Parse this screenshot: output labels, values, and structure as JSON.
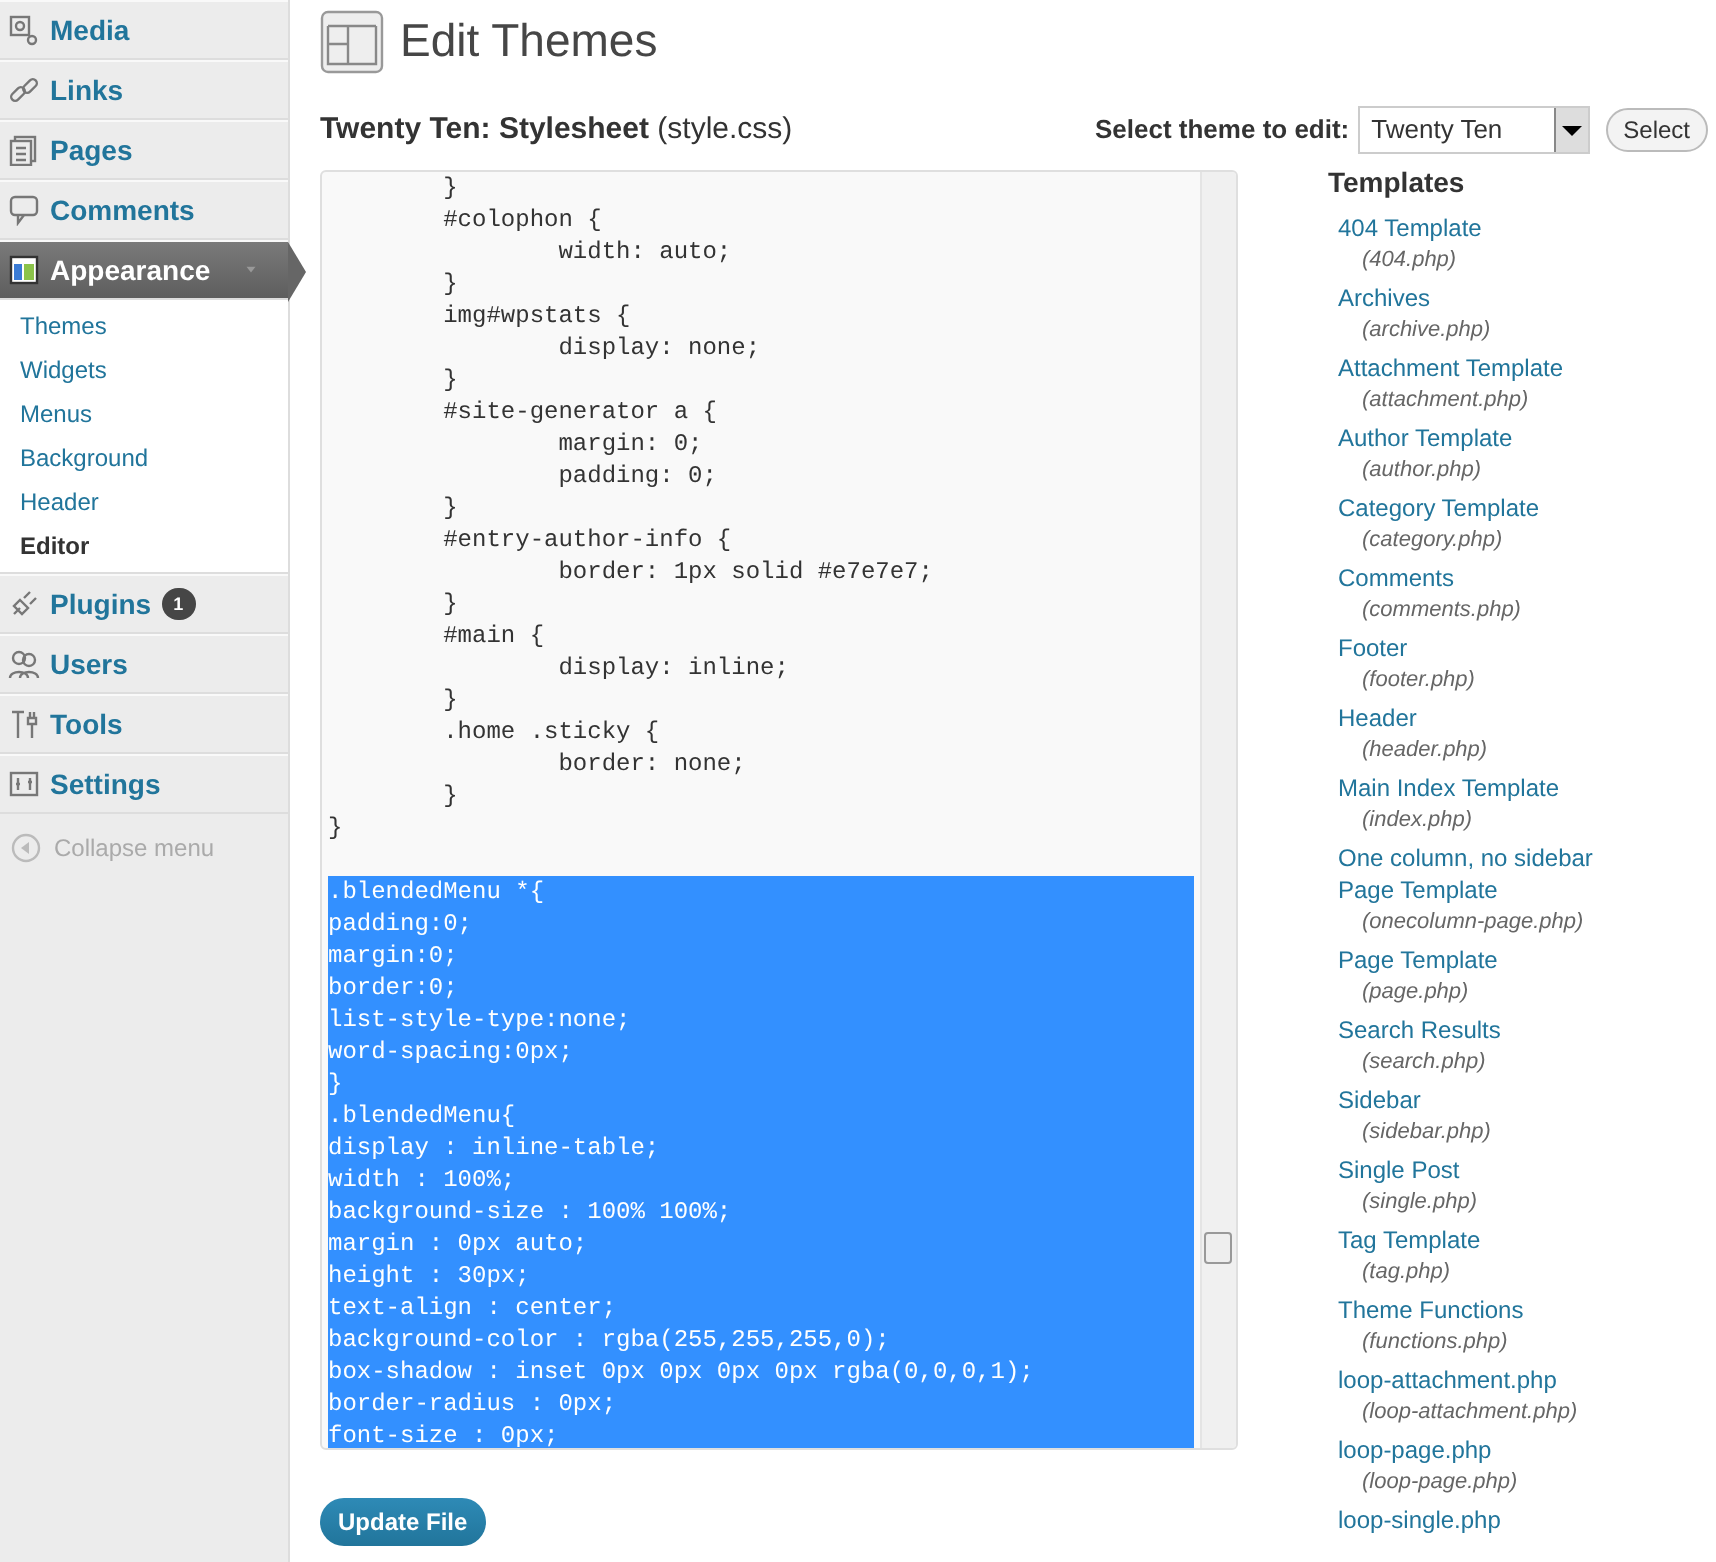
{
  "sidebar": {
    "items": [
      {
        "label": "Media",
        "selected": false
      },
      {
        "label": "Links",
        "selected": false
      },
      {
        "label": "Pages",
        "selected": false
      },
      {
        "label": "Comments",
        "selected": false
      },
      {
        "label": "Appearance",
        "selected": true,
        "submenu": [
          {
            "label": "Themes",
            "selected": false
          },
          {
            "label": "Widgets",
            "selected": false
          },
          {
            "label": "Menus",
            "selected": false
          },
          {
            "label": "Background",
            "selected": false
          },
          {
            "label": "Header",
            "selected": false
          },
          {
            "label": "Editor",
            "selected": true
          }
        ]
      },
      {
        "label": "Plugins",
        "selected": false,
        "badge": "1"
      },
      {
        "label": "Users",
        "selected": false
      },
      {
        "label": "Tools",
        "selected": false
      },
      {
        "label": "Settings",
        "selected": false
      }
    ],
    "collapse": "Collapse menu"
  },
  "title": "Edit Themes",
  "file_heading": {
    "name": "Twenty Ten: Stylesheet",
    "file": "(style.css)"
  },
  "theme_select": {
    "label": "Select theme to edit:",
    "value": "Twenty Ten",
    "button": "Select"
  },
  "editor": {
    "lines": [
      {
        "text": "        }",
        "selected": false
      },
      {
        "text": "        #colophon {",
        "selected": false
      },
      {
        "text": "                width: auto;",
        "selected": false
      },
      {
        "text": "        }",
        "selected": false
      },
      {
        "text": "        img#wpstats {",
        "selected": false
      },
      {
        "text": "                display: none;",
        "selected": false
      },
      {
        "text": "        }",
        "selected": false
      },
      {
        "text": "        #site-generator a {",
        "selected": false
      },
      {
        "text": "                margin: 0;",
        "selected": false
      },
      {
        "text": "                padding: 0;",
        "selected": false
      },
      {
        "text": "        }",
        "selected": false
      },
      {
        "text": "        #entry-author-info {",
        "selected": false
      },
      {
        "text": "                border: 1px solid #e7e7e7;",
        "selected": false
      },
      {
        "text": "        }",
        "selected": false
      },
      {
        "text": "        #main {",
        "selected": false
      },
      {
        "text": "                display: inline;",
        "selected": false
      },
      {
        "text": "        }",
        "selected": false
      },
      {
        "text": "        .home .sticky {",
        "selected": false
      },
      {
        "text": "                border: none;",
        "selected": false
      },
      {
        "text": "        }",
        "selected": false
      },
      {
        "text": "}",
        "selected": false
      },
      {
        "text": ".blendedMenu *{",
        "selected": true
      },
      {
        "text": "padding:0;",
        "selected": true
      },
      {
        "text": "margin:0;",
        "selected": true
      },
      {
        "text": "border:0;",
        "selected": true
      },
      {
        "text": "list-style-type:none;",
        "selected": true
      },
      {
        "text": "word-spacing:0px;",
        "selected": true
      },
      {
        "text": "}",
        "selected": true
      },
      {
        "text": ".blendedMenu{",
        "selected": true
      },
      {
        "text": "display : inline-table;",
        "selected": true
      },
      {
        "text": "width : 100%;",
        "selected": true
      },
      {
        "text": "background-size : 100% 100%;",
        "selected": true
      },
      {
        "text": "margin : 0px auto;",
        "selected": true
      },
      {
        "text": "height : 30px;",
        "selected": true
      },
      {
        "text": "text-align : center;",
        "selected": true
      },
      {
        "text": "background-color : rgba(255,255,255,0);",
        "selected": true
      },
      {
        "text": "box-shadow : inset 0px 0px 0px 0px rgba(0,0,0,1);",
        "selected": true
      },
      {
        "text": "border-radius : 0px;",
        "selected": true
      },
      {
        "text": "font-size : 0px;",
        "selected": true
      }
    ]
  },
  "update_button": "Update File",
  "templates": {
    "heading": "Templates",
    "items": [
      {
        "name": "404 Template",
        "file": "(404.php)"
      },
      {
        "name": "Archives",
        "file": "(archive.php)"
      },
      {
        "name": "Attachment Template",
        "file": "(attachment.php)"
      },
      {
        "name": "Author Template",
        "file": "(author.php)"
      },
      {
        "name": "Category Template",
        "file": "(category.php)"
      },
      {
        "name": "Comments",
        "file": "(comments.php)"
      },
      {
        "name": "Footer",
        "file": "(footer.php)"
      },
      {
        "name": "Header",
        "file": "(header.php)"
      },
      {
        "name": "Main Index Template",
        "file": "(index.php)"
      },
      {
        "name": "One column, no sidebar Page Template",
        "file": "(onecolumn-page.php)"
      },
      {
        "name": "Page Template",
        "file": "(page.php)"
      },
      {
        "name": "Search Results",
        "file": "(search.php)"
      },
      {
        "name": "Sidebar",
        "file": "(sidebar.php)"
      },
      {
        "name": "Single Post",
        "file": "(single.php)"
      },
      {
        "name": "Tag Template",
        "file": "(tag.php)"
      },
      {
        "name": "Theme Functions",
        "file": "(functions.php)"
      },
      {
        "name": "loop-attachment.php",
        "file": "(loop-attachment.php)"
      },
      {
        "name": "loop-page.php",
        "file": "(loop-page.php)"
      },
      {
        "name": "loop-single.php"
      }
    ]
  }
}
